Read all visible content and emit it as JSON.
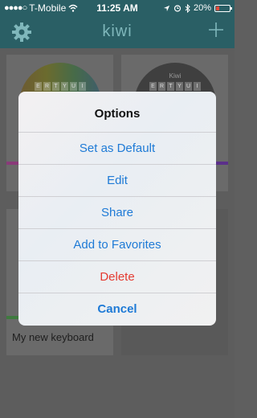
{
  "status_bar": {
    "carrier": "T-Mobile",
    "time": "11:25 AM",
    "battery": "20%",
    "battery_level": 0.2,
    "icons": [
      "signal-dots-icon",
      "wifi-icon",
      "location-arrow-icon",
      "alarm-clock-icon",
      "bluetooth-icon",
      "battery-icon"
    ]
  },
  "nav": {
    "title": "kiwi",
    "left_icon": "gear-icon",
    "right_icon": "plus-icon"
  },
  "keyboards": [
    {
      "brand": "",
      "keys": [
        "E",
        "R",
        "T",
        "Y",
        "U",
        "I"
      ]
    },
    {
      "brand": "Kiwi",
      "keys": [
        "E",
        "R",
        "T",
        "Y",
        "U",
        "I"
      ]
    },
    {
      "label": "My new keyboard"
    }
  ],
  "alert": {
    "title": "Options",
    "actions": [
      {
        "label": "Set as Default"
      },
      {
        "label": "Edit"
      },
      {
        "label": "Share"
      },
      {
        "label": "Add to Favorites"
      },
      {
        "label": "Delete",
        "style": "destructive"
      },
      {
        "label": "Cancel",
        "style": "cancel"
      }
    ]
  },
  "colors": {
    "accent": "#1e7ad6",
    "destructive": "#e43b31",
    "nav_bar": "#2a5f65"
  }
}
